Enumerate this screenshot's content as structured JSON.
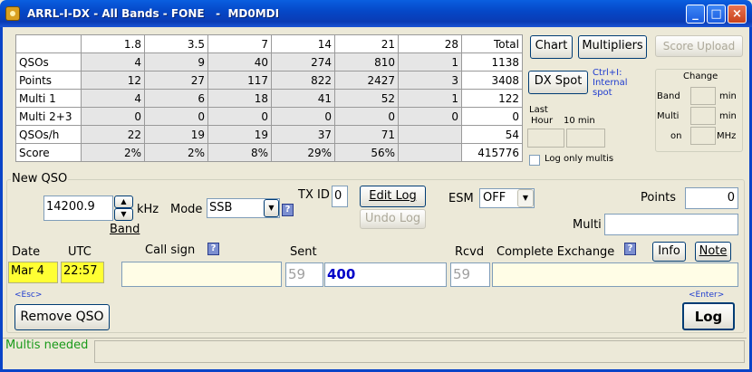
{
  "window": {
    "title": "ARRL-I-DX - All Bands - FONE   -  MD0MDI"
  },
  "stats_table": {
    "headers": [
      "",
      "1.8",
      "3.5",
      "7",
      "14",
      "21",
      "28",
      "Total"
    ],
    "rows": [
      {
        "label": "QSOs",
        "values": [
          "4",
          "9",
          "40",
          "274",
          "810",
          "1",
          "1138"
        ]
      },
      {
        "label": "Points",
        "values": [
          "12",
          "27",
          "117",
          "822",
          "2427",
          "3",
          "3408"
        ]
      },
      {
        "label": "Multi 1",
        "values": [
          "4",
          "6",
          "18",
          "41",
          "52",
          "1",
          "122"
        ]
      },
      {
        "label": "Multi 2+3",
        "values": [
          "0",
          "0",
          "0",
          "0",
          "0",
          "0",
          "0"
        ]
      },
      {
        "label": "QSOs/h",
        "values": [
          "22",
          "19",
          "19",
          "37",
          "71",
          "",
          "54"
        ]
      },
      {
        "label": "Score",
        "values": [
          "2%",
          "2%",
          "8%",
          "29%",
          "56%",
          "",
          "415776"
        ]
      }
    ]
  },
  "right_panel": {
    "chart_label": "Chart",
    "multipliers_label": "Multipliers",
    "score_upload_label": "Score Upload",
    "dx_spot_label": "DX Spot",
    "dx_spot_hint_line1": "Ctrl+I:",
    "dx_spot_hint_line2": "Internal",
    "dx_spot_hint_line3": "spot",
    "last_hour_line1": "Last",
    "last_hour_line2": "Hour",
    "ten_min_label": "10 min",
    "log_only_multis_label": "Log only multis",
    "change_title": "Change",
    "change_band_label": "Band",
    "change_multi_label": "Multi",
    "change_on_label": "on",
    "min_label_1": "min",
    "min_label_2": "min",
    "mhz_label": "MHz"
  },
  "new_qso": {
    "group_label": "New QSO",
    "frequency": "14200.9",
    "khz_label": "kHz",
    "band_label": "Band",
    "mode_label": "Mode",
    "mode_value": "SSB",
    "txid_label": "TX ID",
    "txid_value": "0",
    "edit_log_label": "Edit Log",
    "undo_log_label": "Undo Log",
    "esm_label": "ESM",
    "esm_value": "OFF",
    "points_label": "Points",
    "points_value": "0",
    "multi_label": "Multi",
    "multi_value": "",
    "date_label": "Date",
    "utc_label": "UTC",
    "date_value": "Mar 4",
    "utc_value": "22:57",
    "callsign_label": "Call sign",
    "callsign_value": "",
    "sent_label": "Sent",
    "sent_rst": "59",
    "sent_exchange": "400",
    "rcvd_label": "Rcvd",
    "rcvd_rst": "59",
    "complete_exchange_label": "Complete Exchange",
    "exchange_value": "",
    "info_label": "Info",
    "note_label": "Note",
    "esc_hint": "<Esc>",
    "enter_hint": "<Enter>",
    "remove_qso_label": "Remove QSO",
    "log_label": "Log",
    "help_glyph": "?"
  },
  "status_bar": {
    "text": "Multis needed",
    "text_color": "#1a9a1a"
  },
  "colors": {
    "title_blue": "#0548c8",
    "highlight_yellow": "#ffff33",
    "exchange_blue": "#0000c8"
  }
}
